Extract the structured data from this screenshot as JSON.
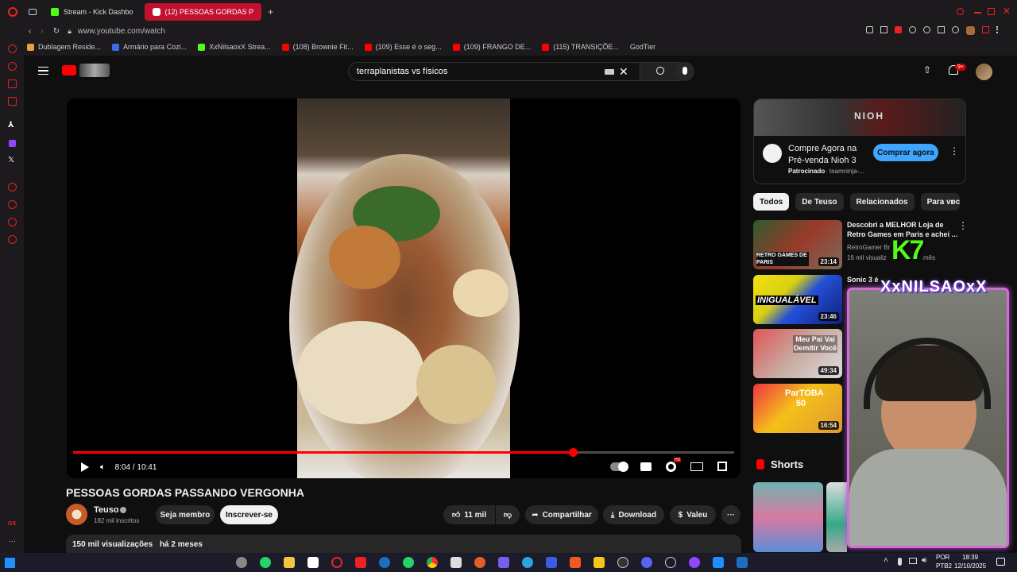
{
  "browser": {
    "tabs": [
      {
        "label": "Stream - Kick Dashbo",
        "color": "#53fc18"
      },
      {
        "label": "(12) PESSOAS GORDAS P",
        "color": "#ff0000"
      }
    ],
    "new_tab": "+",
    "url": "www.youtube.com/watch",
    "bookmarks": [
      {
        "label": "Dublagem Reside...",
        "color": "#e6a23c"
      },
      {
        "label": "Armário para Cozi...",
        "color": "#3a6ee8"
      },
      {
        "label": "XxNilsaoxX Strea...",
        "color": "#53fc18"
      },
      {
        "label": "(108) Brownie Fit...",
        "color": "#ff0000"
      },
      {
        "label": "(109) Esse é o seg...",
        "color": "#ff0000"
      },
      {
        "label": "(109) FRANGO DE...",
        "color": "#ff0000"
      },
      {
        "label": "(115) TRANSIÇÕE...",
        "color": "#ff0000"
      },
      {
        "label": "GodTier",
        "color": "#1d1a1e"
      }
    ]
  },
  "youtube": {
    "search_query": "terraplanistas vs físicos",
    "notification_badge": "9+",
    "video": {
      "time": "8:04 / 10:41",
      "progress": 0.756,
      "title": "PESSOAS GORDAS PASSANDO VERGONHA",
      "hd_badge": "HD"
    },
    "channel": {
      "name": "Teuso",
      "subscribers": "182 mil inscritos",
      "join_label": "Seja membro",
      "subscribe_label": "Inscrever-se"
    },
    "actions": {
      "likes": "11 mil",
      "share": "Compartilhar",
      "download": "Download",
      "thanks": "Valeu"
    },
    "description": {
      "views": "150 mil visualizações",
      "age": "há 2 meses"
    },
    "ad": {
      "title_line1": "Compre Agora na",
      "title_line2": "Pré-venda Nioh 3",
      "sponsored": "Patrocinado",
      "advertiser": "· teamninja-...",
      "cta": "Comprar agora",
      "banner_text": "NIOH"
    },
    "chips": [
      "Todos",
      "De Teuso",
      "Relacionados",
      "Para você"
    ],
    "recommendations": [
      {
        "title": "Descobri a MELHOR Loja de Retro Games em Paris e achei ...",
        "channel": "RetroGamer Br",
        "meta": "16 mil visualiz",
        "meta2": "mês",
        "duration": "23:14",
        "thumb_text": "RETRO GAMES DE PARIS"
      },
      {
        "title": "Sonic 3 é",
        "channel": "",
        "meta": "",
        "meta2": "",
        "duration": "23:46",
        "thumb_text": "INIGUALÁVEL"
      },
      {
        "title": "",
        "channel": "",
        "meta": "",
        "meta2": "",
        "duration": "49:34",
        "thumb_text": "Meu Pai Vai Demitir Você"
      },
      {
        "title": "",
        "channel": "",
        "meta": "",
        "meta2": "",
        "duration": "16:54",
        "thumb_text": "ParTOBA 50"
      }
    ],
    "shorts_label": "Shorts"
  },
  "overlay": {
    "streamer_name": "XxNILSAOxX",
    "kick_logo": "K7"
  },
  "taskbar": {
    "language": "POR",
    "layout": "PTB2",
    "time": "18:39",
    "date": "12/10/2025"
  }
}
